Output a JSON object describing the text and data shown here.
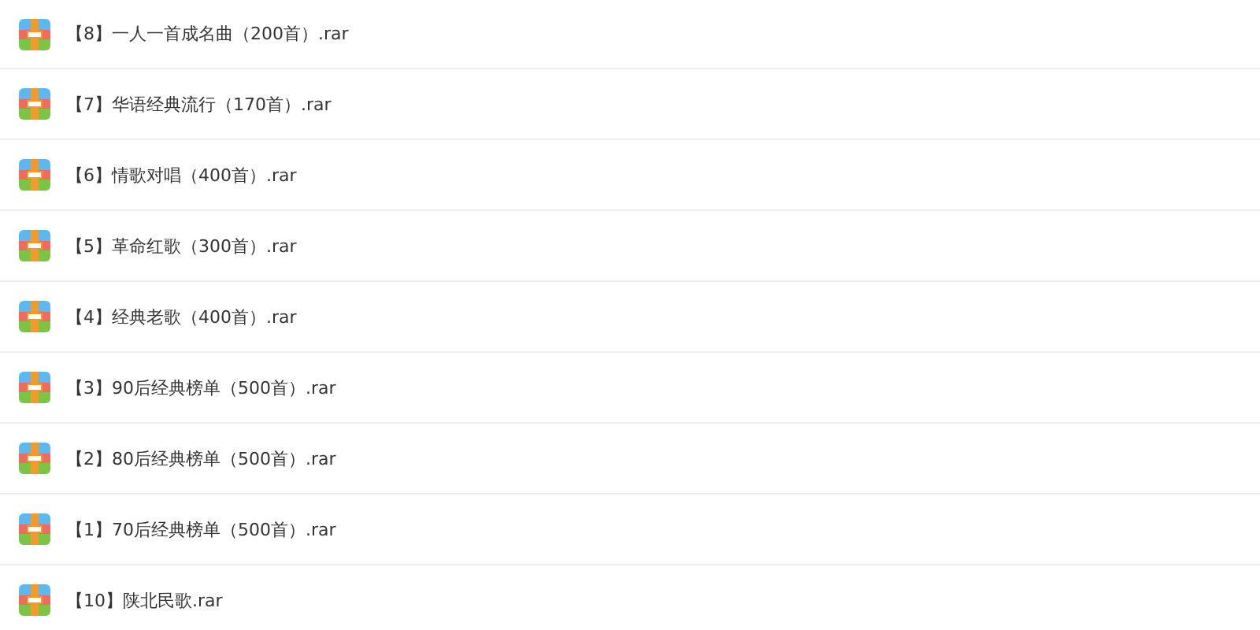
{
  "files": [
    {
      "name": "【8】一人一首成名曲（200首）.rar"
    },
    {
      "name": "【7】华语经典流行（170首）.rar"
    },
    {
      "name": "【6】情歌对唱（400首）.rar"
    },
    {
      "name": "【5】革命红歌（300首）.rar"
    },
    {
      "name": "【4】经典老歌（400首）.rar"
    },
    {
      "name": "【3】90后经典榜单（500首）.rar"
    },
    {
      "name": "【2】80后经典榜单（500首）.rar"
    },
    {
      "name": "【1】70后经典榜单（500首）.rar"
    },
    {
      "name": "【10】陕北民歌.rar"
    }
  ]
}
